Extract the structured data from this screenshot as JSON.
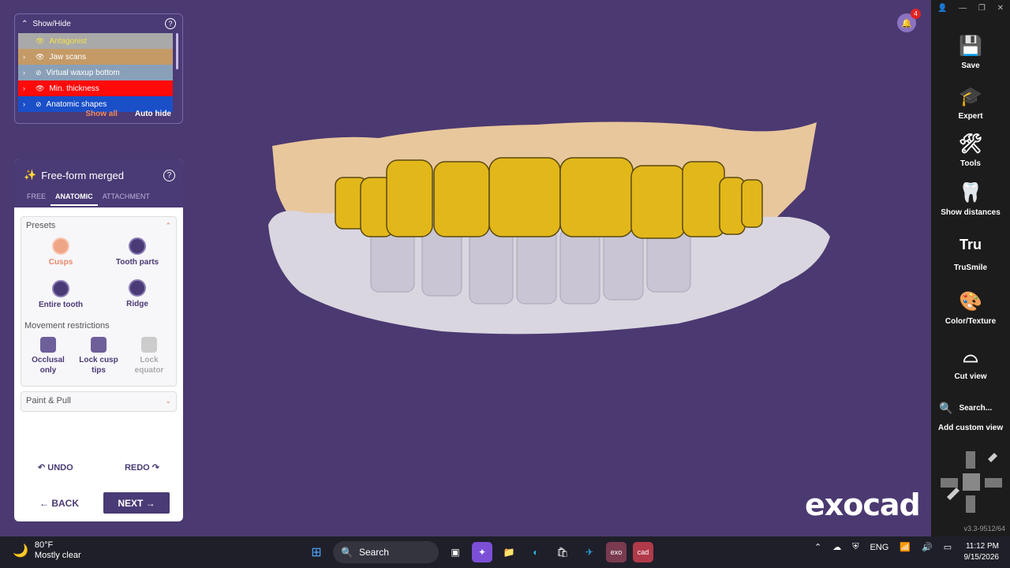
{
  "notifications": {
    "count": "4"
  },
  "brand": {
    "logo": "exocad"
  },
  "show_hide": {
    "title": "Show/Hide",
    "items": [
      {
        "label": "Antagonist",
        "bg": "#a9a9a9",
        "color": "#f5e04a",
        "visible": true
      },
      {
        "label": "Jaw scans",
        "bg": "#c49a66",
        "color": "#ffffff",
        "visible": true
      },
      {
        "label": "Virtual waxup bottom",
        "bg": "#8aa0b8",
        "color": "#ffffff",
        "visible": false
      },
      {
        "label": "Min. thickness",
        "bg": "#ff0a0a",
        "color": "#ffffff",
        "visible": true
      },
      {
        "label": "Anatomic shapes",
        "bg": "#1a4fc8",
        "color": "#ffffff",
        "visible": false
      }
    ],
    "show_all": "Show all",
    "auto_hide": "Auto hide"
  },
  "freeform": {
    "title": "Free-form merged",
    "tabs": [
      "FREE",
      "ANATOMIC",
      "ATTACHMENT"
    ],
    "active_tab": "ANATOMIC",
    "presets_label": "Presets",
    "presets": [
      "Cusps",
      "Tooth parts",
      "Entire tooth",
      "Ridge"
    ],
    "movement_label": "Movement restrictions",
    "movement": [
      {
        "line1": "Occlusal",
        "line2": "only"
      },
      {
        "line1": "Lock cusp",
        "line2": "tips"
      },
      {
        "line1": "Lock",
        "line2": "equator"
      }
    ],
    "paint_pull": "Paint & Pull",
    "undo": "UNDO",
    "redo": "REDO",
    "back": "BACK",
    "next": "NEXT"
  },
  "toolbar": {
    "items": [
      "Save",
      "Expert",
      "Tools",
      "Show distances",
      "TruSmile",
      "Color/Texture",
      "Cut view"
    ],
    "search": "Search...",
    "add_view": "Add custom view",
    "version": "v3.3-9512/64"
  },
  "taskbar": {
    "temp": "80°F",
    "weather": "Mostly clear",
    "search": "Search",
    "lang": "ENG",
    "time": "11:12 PM",
    "date": "9/15/2026"
  }
}
